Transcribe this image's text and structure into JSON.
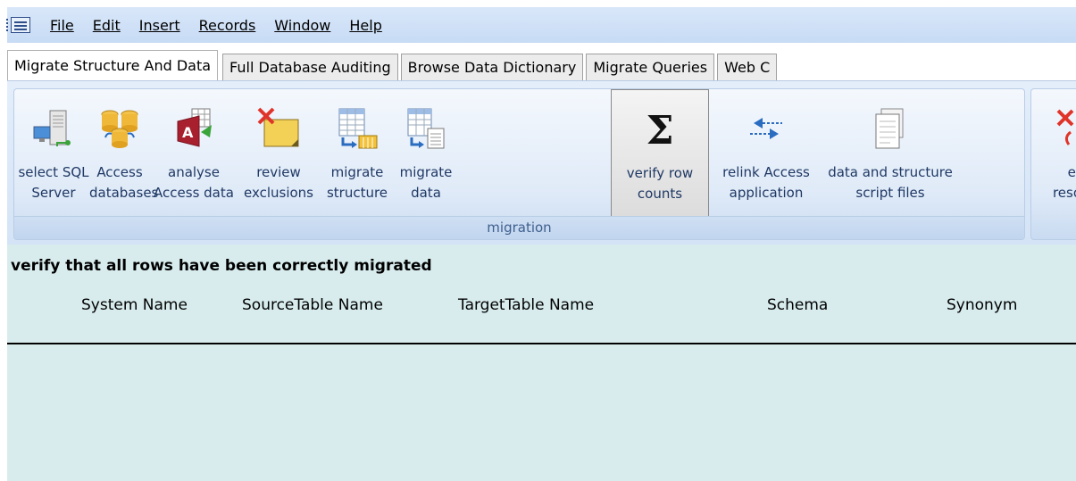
{
  "menu": {
    "items": [
      {
        "label": "File"
      },
      {
        "label": "Edit"
      },
      {
        "label": "Insert"
      },
      {
        "label": "Records"
      },
      {
        "label": "Window"
      },
      {
        "label": "Help"
      }
    ]
  },
  "tabs": [
    {
      "label": "Migrate Structure And Data",
      "active": true
    },
    {
      "label": "Full Database Auditing"
    },
    {
      "label": "Browse Data Dictionary"
    },
    {
      "label": "Migrate Queries"
    },
    {
      "label": "Web C"
    }
  ],
  "ribbon": {
    "group_label": "migration",
    "buttons": [
      {
        "line1": "select SQL",
        "line2": "Server",
        "icon": "server-icon"
      },
      {
        "line1": "Access",
        "line2": "databases",
        "icon": "databases-icon"
      },
      {
        "line1": "analyse",
        "line2": "Access data",
        "icon": "access-analyse-icon"
      },
      {
        "line1": "review",
        "line2": "exclusions",
        "icon": "exclusions-icon"
      },
      {
        "line1": "migrate",
        "line2": "structure",
        "icon": "migrate-structure-icon"
      },
      {
        "line1": "migrate",
        "line2": "data",
        "icon": "migrate-data-icon"
      },
      {
        "line1": "verify row",
        "line2": "counts",
        "icon": "sigma-icon"
      },
      {
        "line1": "relink Access",
        "line2": "application",
        "icon": "relink-arrows-icon"
      },
      {
        "line1": "data and structure",
        "line2": "script files",
        "icon": "script-files-icon"
      }
    ],
    "overflow_button": {
      "line1": "er",
      "line2": "reso",
      "icon": "red-x-icon"
    }
  },
  "main": {
    "title": "verify that all rows have been correctly migrated",
    "columns": [
      "System Name",
      "SourceTable Name",
      "TargetTable Name",
      "Schema",
      "Synonym"
    ]
  },
  "colors": {
    "content_bg": "#d8ecee",
    "ribbon_bg": "#dfeaf8",
    "label_text": "#1f3864"
  }
}
